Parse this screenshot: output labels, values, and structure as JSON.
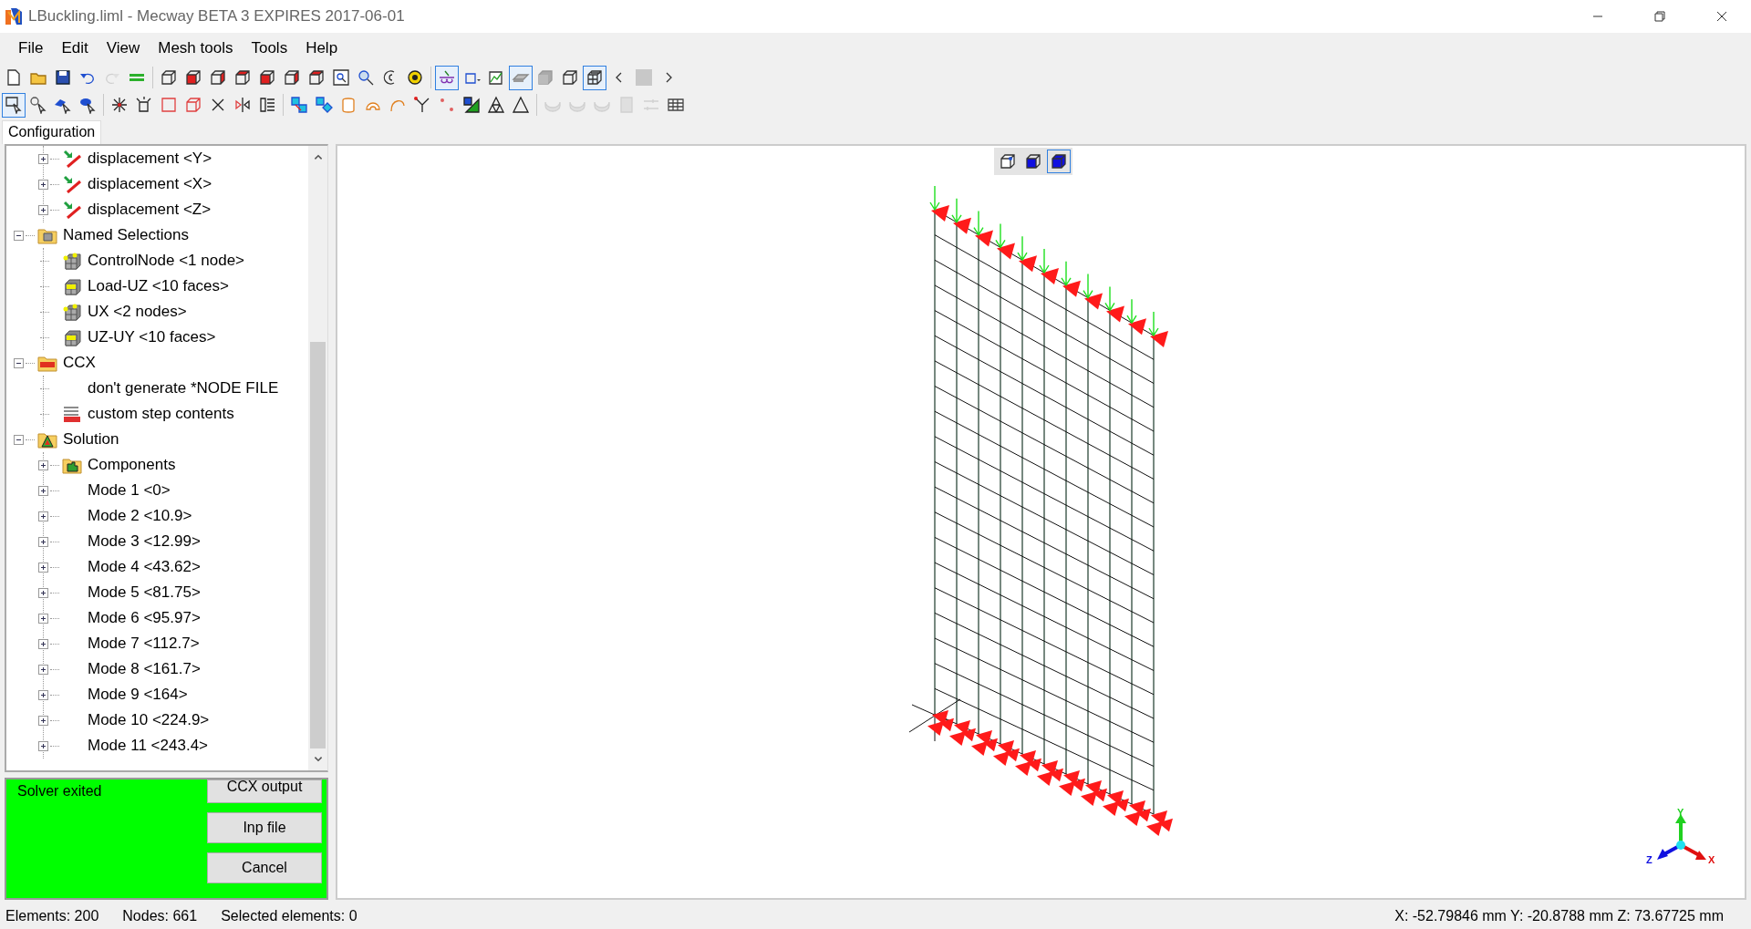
{
  "window": {
    "title": "LBuckling.liml - Mecway BETA 3 EXPIRES 2017-06-01"
  },
  "menu": [
    "File",
    "Edit",
    "View",
    "Mesh tools",
    "Tools",
    "Help"
  ],
  "toolbar_rows": [
    [
      {
        "pressed": false,
        "disabled": false
      },
      {
        "pressed": false,
        "disabled": false
      },
      {
        "pressed": false,
        "disabled": false
      },
      {
        "pressed": false,
        "disabled": false
      },
      {
        "pressed": false,
        "disabled": true
      },
      {
        "pressed": false,
        "disabled": false
      },
      {
        "pressed": false,
        "disabled": false
      },
      {
        "pressed": false,
        "disabled": false
      },
      {
        "pressed": false,
        "disabled": false
      },
      {
        "pressed": false,
        "disabled": false
      },
      {
        "pressed": false,
        "disabled": false
      },
      {
        "pressed": false,
        "disabled": false
      },
      {
        "pressed": false,
        "disabled": false
      },
      {
        "pressed": false,
        "disabled": false
      },
      {
        "pressed": false,
        "disabled": false
      },
      {
        "pressed": false,
        "disabled": false
      },
      {
        "pressed": false,
        "disabled": false
      },
      {
        "pressed": true,
        "disabled": false
      },
      {
        "pressed": false,
        "disabled": false
      },
      {
        "pressed": false,
        "disabled": false
      },
      {
        "pressed": true,
        "disabled": false
      },
      {
        "pressed": false,
        "disabled": false
      },
      {
        "pressed": false,
        "disabled": false
      },
      {
        "pressed": true,
        "disabled": false
      },
      {
        "pressed": false,
        "disabled": false
      },
      {
        "pressed": false,
        "disabled": false
      },
      {
        "pressed": false,
        "disabled": false
      }
    ],
    [
      {
        "pressed": true,
        "disabled": false
      },
      {
        "pressed": false,
        "disabled": false
      },
      {
        "pressed": false,
        "disabled": false
      },
      {
        "pressed": false,
        "disabled": false
      },
      {
        "pressed": false,
        "disabled": false
      },
      {
        "pressed": false,
        "disabled": false
      },
      {
        "pressed": false,
        "disabled": false
      },
      {
        "pressed": false,
        "disabled": false
      },
      {
        "pressed": false,
        "disabled": false
      },
      {
        "pressed": false,
        "disabled": false
      },
      {
        "pressed": false,
        "disabled": false
      },
      {
        "pressed": false,
        "disabled": false
      },
      {
        "pressed": false,
        "disabled": false
      },
      {
        "pressed": false,
        "disabled": false
      },
      {
        "pressed": false,
        "disabled": false
      },
      {
        "pressed": false,
        "disabled": false
      },
      {
        "pressed": false,
        "disabled": false
      },
      {
        "pressed": false,
        "disabled": false
      },
      {
        "pressed": false,
        "disabled": false
      },
      {
        "pressed": false,
        "disabled": false
      },
      {
        "pressed": false,
        "disabled": false
      },
      {
        "pressed": false,
        "disabled": true
      },
      {
        "pressed": false,
        "disabled": true
      },
      {
        "pressed": false,
        "disabled": true
      },
      {
        "pressed": false,
        "disabled": true
      },
      {
        "pressed": false,
        "disabled": true
      },
      {
        "pressed": false,
        "disabled": false
      }
    ]
  ],
  "tabs": [
    {
      "label": "Configuration",
      "selected": true
    }
  ],
  "tree": {
    "continued_children": [
      {
        "label": "displacement <Y>",
        "kind": "displacement",
        "expanded": false
      },
      {
        "label": "displacement <X>",
        "kind": "displacement",
        "expanded": false
      },
      {
        "label": "displacement <Z>",
        "kind": "displacement",
        "expanded": false
      }
    ],
    "items": [
      {
        "label": "Named Selections",
        "kind": "selection-folder",
        "expanded": true,
        "children": [
          {
            "label": "ControlNode <1 node>",
            "kind": "node-selection"
          },
          {
            "label": "Load-UZ <10 faces>",
            "kind": "face-selection"
          },
          {
            "label": "UX <2 nodes>",
            "kind": "node-selection"
          },
          {
            "label": "UZ-UY <10 faces>",
            "kind": "face-selection"
          }
        ]
      },
      {
        "label": "CCX",
        "kind": "ccx-folder",
        "expanded": true,
        "children": [
          {
            "label": "don't generate *NODE FILE",
            "kind": "plain"
          },
          {
            "label": "custom step contents",
            "kind": "ccx-step"
          }
        ]
      },
      {
        "label": "Solution",
        "kind": "solution-folder",
        "expanded": true,
        "children": [
          {
            "label": "Components",
            "kind": "components-folder",
            "expanded": false
          },
          {
            "label": "Mode 1 <0>",
            "kind": "plain",
            "expanded": false
          },
          {
            "label": "Mode 2 <10.9>",
            "kind": "plain",
            "expanded": false
          },
          {
            "label": "Mode 3 <12.99>",
            "kind": "plain",
            "expanded": false
          },
          {
            "label": "Mode 4 <43.62>",
            "kind": "plain",
            "expanded": false
          },
          {
            "label": "Mode 5 <81.75>",
            "kind": "plain",
            "expanded": false
          },
          {
            "label": "Mode 6 <95.97>",
            "kind": "plain",
            "expanded": false
          },
          {
            "label": "Mode 7 <112.7>",
            "kind": "plain",
            "expanded": false
          },
          {
            "label": "Mode 8 <161.7>",
            "kind": "plain",
            "expanded": false
          },
          {
            "label": "Mode 9 <164>",
            "kind": "plain",
            "expanded": false
          },
          {
            "label": "Mode 10 <224.9>",
            "kind": "plain",
            "expanded": false
          },
          {
            "label": "Mode 11 <243.4>",
            "kind": "plain",
            "expanded": false
          }
        ]
      }
    ]
  },
  "solver": {
    "status": "Solver exited",
    "buttons": [
      "CCX output",
      "Inp file",
      "Cancel"
    ]
  },
  "view_buttons": [
    {
      "pressed": false
    },
    {
      "pressed": false
    },
    {
      "pressed": true
    }
  ],
  "axes": [
    {
      "label": "Y"
    },
    {
      "label": "Z"
    },
    {
      "label": "X"
    }
  ],
  "status_bar": {
    "elements": "Elements: 200",
    "nodes": "Nodes: 661",
    "selected": "Selected elements: 0",
    "coordinates": "X: -52.79846 mm Y: -20.8788 mm Z: 73.67725 mm"
  }
}
